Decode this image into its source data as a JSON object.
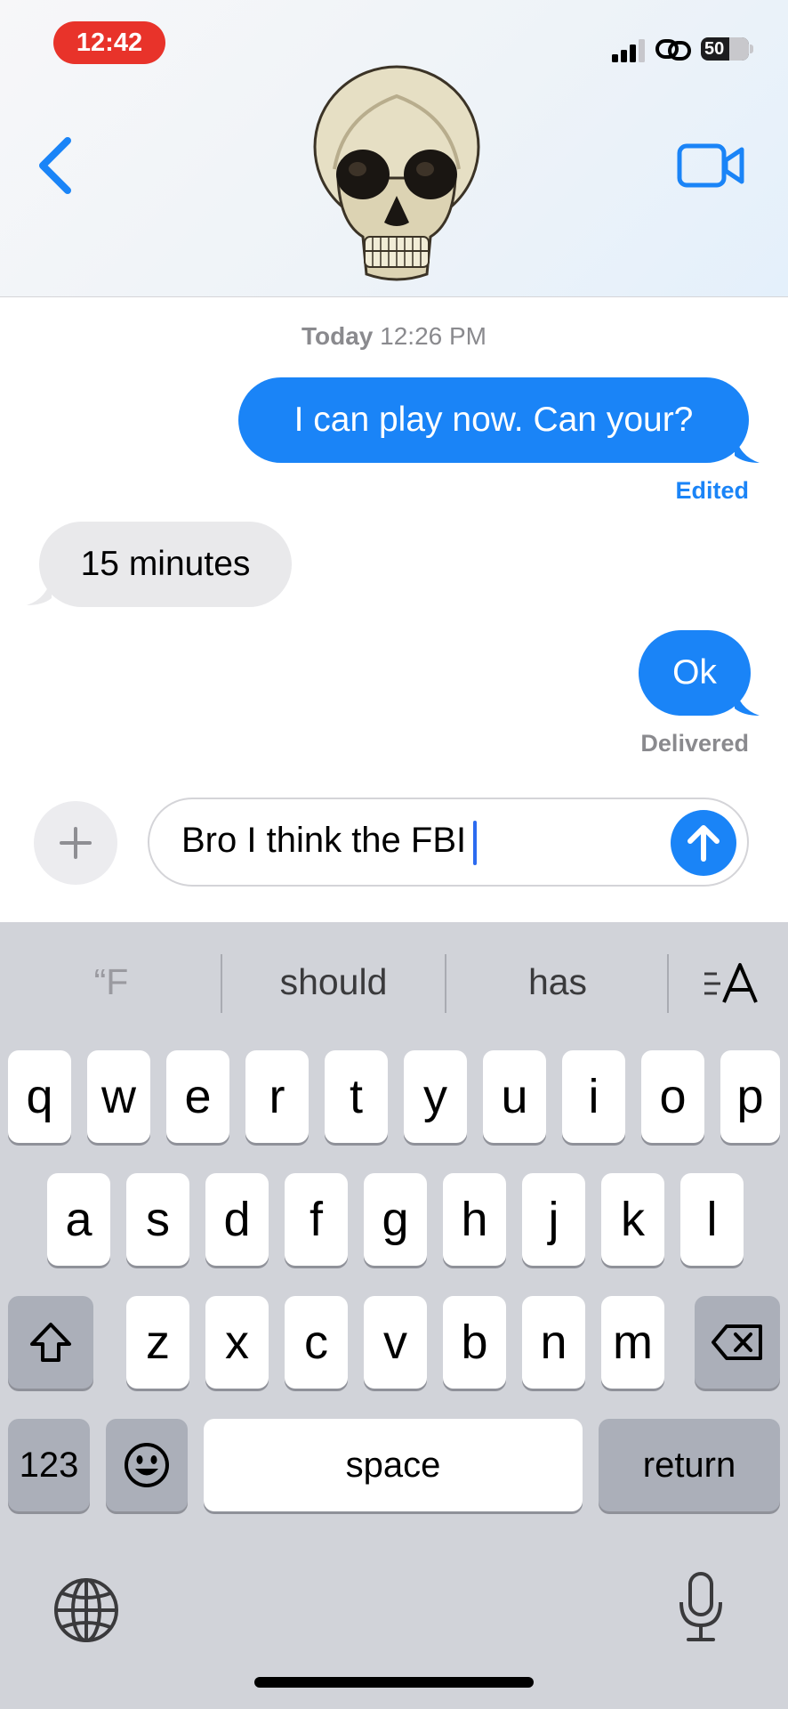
{
  "status_bar": {
    "time": "12:42",
    "battery": "50"
  },
  "header": {
    "avatar_icon": "skull-avatar",
    "back_icon": "chevron-left-icon",
    "video_icon": "video-camera-icon",
    "accent_color": "#1a84f7"
  },
  "conversation": {
    "timestamp_day": "Today",
    "timestamp_time": "12:26 PM",
    "messages": [
      {
        "direction": "outgoing",
        "text": "I can play now. Can your?",
        "note": "Edited"
      },
      {
        "direction": "incoming",
        "text": "15 minutes"
      },
      {
        "direction": "outgoing",
        "text": "Ok",
        "note": "Delivered"
      }
    ]
  },
  "composer": {
    "text": "Bro I think the FBI",
    "plus_icon": "plus-icon",
    "send_icon": "arrow-up-icon"
  },
  "keyboard": {
    "predictions": [
      "“F",
      "should",
      "has"
    ],
    "format_icon": "text-format-icon",
    "row1": [
      "q",
      "w",
      "e",
      "r",
      "t",
      "y",
      "u",
      "i",
      "o",
      "p"
    ],
    "row2": [
      "a",
      "s",
      "d",
      "f",
      "g",
      "h",
      "j",
      "k",
      "l"
    ],
    "row3": [
      "z",
      "x",
      "c",
      "v",
      "b",
      "n",
      "m"
    ],
    "numbers_label": "123",
    "space_label": "space",
    "return_label": "return",
    "emoji_icon": "emoji-icon",
    "globe_icon": "globe-icon",
    "mic_icon": "microphone-icon",
    "shift_icon": "shift-icon",
    "delete_icon": "delete-icon"
  }
}
